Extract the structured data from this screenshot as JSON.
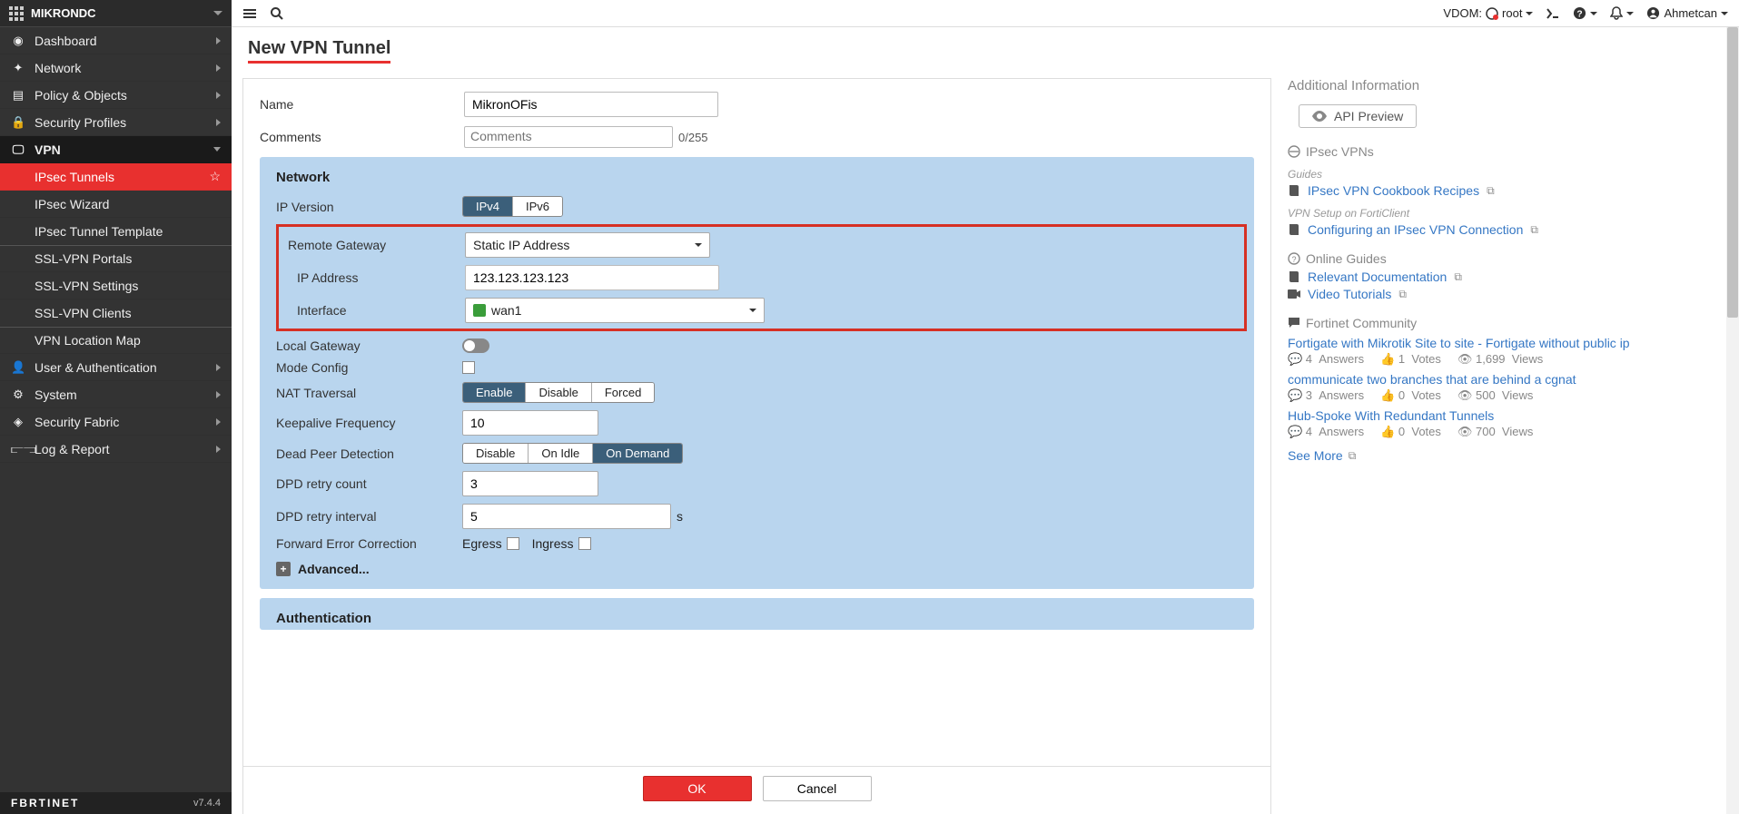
{
  "brand": {
    "name": "MIKRONDC"
  },
  "version": "v7.4.4",
  "fortinet_logo": "FBRTINET",
  "topbar": {
    "vdom_label": "VDOM:",
    "vdom_value": "root",
    "username": "Ahmetcan"
  },
  "sidebar": [
    {
      "icon": "dashboard-icon",
      "label": "Dashboard",
      "children": null,
      "expand": true
    },
    {
      "icon": "network-icon",
      "label": "Network",
      "children": null,
      "expand": true
    },
    {
      "icon": "policy-icon",
      "label": "Policy & Objects",
      "children": null,
      "expand": true
    },
    {
      "icon": "lock-icon",
      "label": "Security Profiles",
      "children": null,
      "expand": true
    },
    {
      "icon": "vpn-icon",
      "label": "VPN",
      "expanded": true,
      "children": [
        {
          "label": "IPsec Tunnels",
          "active": true,
          "starred": true
        },
        {
          "label": "IPsec Wizard"
        },
        {
          "label": "IPsec Tunnel Template"
        },
        {
          "label": "SSL-VPN Portals"
        },
        {
          "label": "SSL-VPN Settings"
        },
        {
          "label": "SSL-VPN Clients"
        },
        {
          "label": "VPN Location Map"
        }
      ]
    },
    {
      "icon": "user-icon",
      "label": "User & Authentication",
      "expand": true
    },
    {
      "icon": "gear-icon",
      "label": "System",
      "expand": true
    },
    {
      "icon": "fabric-icon",
      "label": "Security Fabric",
      "expand": true
    },
    {
      "icon": "log-icon",
      "label": "Log & Report",
      "expand": true
    }
  ],
  "page_title": "New VPN Tunnel",
  "form": {
    "name_label": "Name",
    "name_value": "MikronOFis",
    "comments_label": "Comments",
    "comments_placeholder": "Comments",
    "comments_count": "0/255",
    "network": {
      "section": "Network",
      "ip_version_label": "IP Version",
      "ip_version_options": [
        "IPv4",
        "IPv6"
      ],
      "ip_version_active": 0,
      "remote_gateway_label": "Remote Gateway",
      "remote_gateway_value": "Static IP Address",
      "ip_address_label": "IP Address",
      "ip_address_value": "123.123.123.123",
      "interface_label": "Interface",
      "interface_value": "wan1",
      "local_gateway_label": "Local Gateway",
      "mode_config_label": "Mode Config",
      "nat_traversal_label": "NAT Traversal",
      "nat_options": [
        "Enable",
        "Disable",
        "Forced"
      ],
      "nat_active": 0,
      "keepalive_label": "Keepalive Frequency",
      "keepalive_value": "10",
      "dpd_label": "Dead Peer Detection",
      "dpd_options": [
        "Disable",
        "On Idle",
        "On Demand"
      ],
      "dpd_active": 2,
      "dpd_retry_count_label": "DPD retry count",
      "dpd_retry_count_value": "3",
      "dpd_retry_interval_label": "DPD retry interval",
      "dpd_retry_interval_value": "5",
      "dpd_retry_interval_unit": "s",
      "fec_label": "Forward Error Correction",
      "fec_egress": "Egress",
      "fec_ingress": "Ingress",
      "advanced_label": "Advanced..."
    },
    "auth": {
      "section": "Authentication"
    },
    "buttons": {
      "ok": "OK",
      "cancel": "Cancel"
    }
  },
  "right": {
    "title": "Additional Information",
    "api_preview": "API Preview",
    "ipsec_vpns": {
      "heading": "IPsec VPNs",
      "guides_sub": "Guides",
      "cookbook": "IPsec VPN Cookbook Recipes",
      "forticlient_sub": "VPN Setup on FortiClient",
      "config_link": "Configuring an IPsec VPN Connection"
    },
    "online_guides": {
      "heading": "Online Guides",
      "doc": "Relevant Documentation",
      "video": "Video Tutorials"
    },
    "community": {
      "heading": "Fortinet Community",
      "items": [
        {
          "title": "Fortigate with Mikrotik Site to site - Fortigate without public ip",
          "answers": "4",
          "votes": "1",
          "views": "1,699"
        },
        {
          "title": "communicate two branches that are behind a cgnat",
          "answers": "3",
          "votes": "0",
          "views": "500"
        },
        {
          "title": "Hub-Spoke With Redundant Tunnels",
          "answers": "4",
          "votes": "0",
          "views": "700"
        }
      ],
      "answers_label": "Answers",
      "votes_label": "Votes",
      "views_label": "Views",
      "see_more": "See More"
    }
  }
}
